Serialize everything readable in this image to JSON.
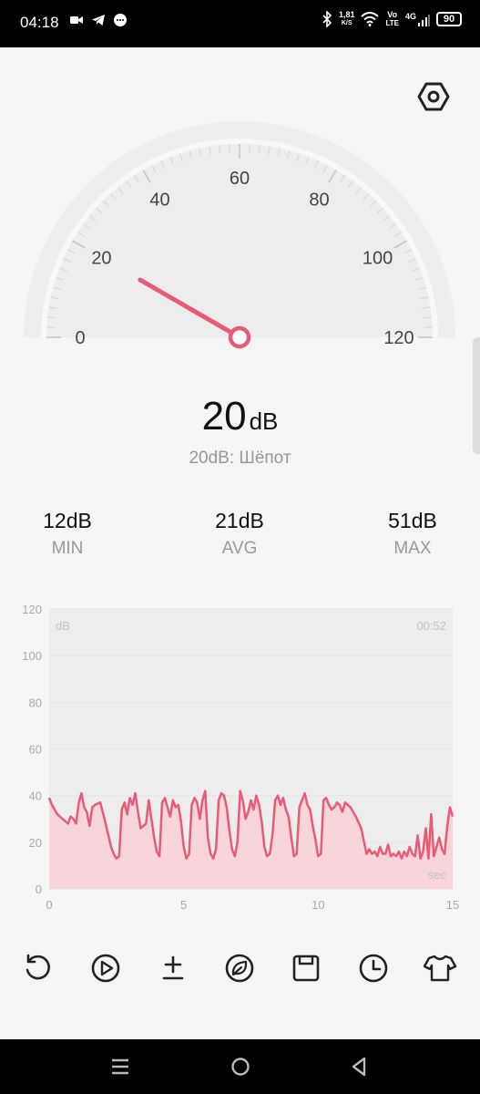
{
  "status_bar": {
    "time": "04:18",
    "speed_top": "1,81",
    "speed_bottom": "K/S",
    "volte_top": "Vo",
    "volte_bottom": "LTE",
    "network": "4G",
    "battery": "90"
  },
  "gauge": {
    "ticks": [
      "0",
      "20",
      "40",
      "60",
      "80",
      "100",
      "120"
    ],
    "value": 20,
    "max": 120
  },
  "reading": {
    "value": "20",
    "unit": "dB",
    "description": "20dB: Шёпот"
  },
  "stats": {
    "min": {
      "value": "12dB",
      "label": "MIN"
    },
    "avg": {
      "value": "21dB",
      "label": "AVG"
    },
    "max": {
      "value": "51dB",
      "label": "MAX"
    }
  },
  "chart_data": {
    "type": "area",
    "y_unit_label": "dB",
    "timer": "00:52",
    "x_unit_label": "sec",
    "ylim": [
      0,
      120
    ],
    "xlim": [
      0,
      15
    ],
    "y_ticks": [
      "0",
      "20",
      "40",
      "60",
      "80",
      "100",
      "120"
    ],
    "x_ticks": [
      "0",
      "5",
      "10",
      "15"
    ],
    "x": [
      0,
      0.1,
      0.3,
      0.5,
      0.7,
      0.8,
      0.9,
      1.0,
      1.1,
      1.2,
      1.3,
      1.4,
      1.5,
      1.6,
      1.7,
      1.9,
      2.1,
      2.3,
      2.4,
      2.5,
      2.6,
      2.7,
      2.8,
      2.9,
      3.0,
      3.1,
      3.2,
      3.3,
      3.4,
      3.5,
      3.6,
      3.7,
      3.9,
      4.0,
      4.1,
      4.2,
      4.3,
      4.4,
      4.5,
      4.6,
      4.7,
      4.8,
      4.9,
      5.0,
      5.1,
      5.2,
      5.3,
      5.4,
      5.5,
      5.6,
      5.7,
      5.8,
      5.9,
      6.0,
      6.1,
      6.2,
      6.3,
      6.4,
      6.5,
      6.6,
      6.7,
      6.8,
      6.9,
      7.0,
      7.1,
      7.2,
      7.3,
      7.4,
      7.5,
      7.6,
      7.7,
      7.8,
      7.9,
      8.0,
      8.1,
      8.2,
      8.3,
      8.4,
      8.5,
      8.6,
      8.7,
      8.8,
      8.9,
      9.0,
      9.1,
      9.2,
      9.3,
      9.4,
      9.5,
      9.6,
      9.7,
      9.8,
      9.9,
      10.0,
      10.1,
      10.2,
      10.3,
      10.4,
      10.5,
      10.6,
      10.7,
      10.8,
      10.9,
      11.0,
      11.2,
      11.4,
      11.6,
      11.8,
      11.9,
      12.0,
      12.1,
      12.2,
      12.3,
      12.4,
      12.5,
      12.6,
      12.7,
      12.8,
      12.9,
      13.0,
      13.1,
      13.2,
      13.3,
      13.4,
      13.5,
      13.6,
      13.7,
      13.8,
      13.9,
      14.0,
      14.1,
      14.2,
      14.3,
      14.4,
      14.5,
      14.6,
      14.7,
      14.8,
      14.9,
      15.0
    ],
    "values": [
      39,
      36,
      32,
      30,
      28,
      31,
      30,
      28,
      37,
      41,
      35,
      33,
      27,
      35,
      36,
      37,
      28,
      18,
      15,
      13,
      14,
      34,
      37,
      32,
      39,
      36,
      41,
      33,
      26,
      27,
      28,
      38,
      22,
      16,
      14,
      37,
      39,
      35,
      31,
      38,
      35,
      36,
      29,
      18,
      13,
      15,
      36,
      39,
      37,
      30,
      38,
      42,
      22,
      15,
      13,
      17,
      38,
      41,
      40,
      35,
      25,
      17,
      14,
      20,
      42,
      38,
      30,
      33,
      38,
      34,
      40,
      36,
      29,
      18,
      14,
      15,
      23,
      38,
      40,
      36,
      39,
      34,
      31,
      22,
      14,
      15,
      35,
      38,
      41,
      36,
      34,
      27,
      21,
      14,
      15,
      38,
      39,
      36,
      34,
      35,
      37,
      36,
      33,
      37,
      35,
      31,
      26,
      15,
      17,
      15,
      16,
      14,
      18,
      15,
      15,
      19,
      14,
      15,
      14,
      16,
      13,
      16,
      14,
      18,
      15,
      14,
      23,
      13,
      16,
      26,
      13,
      32,
      14,
      18,
      22,
      17,
      15,
      27,
      35,
      31,
      20
    ]
  },
  "toolbar": {
    "buttons": [
      "reset",
      "play",
      "calibrate",
      "eco",
      "save",
      "history",
      "theme"
    ]
  },
  "colors": {
    "accent": "#e95a74",
    "fill": "#f8d5da",
    "grid": "#ececec"
  }
}
